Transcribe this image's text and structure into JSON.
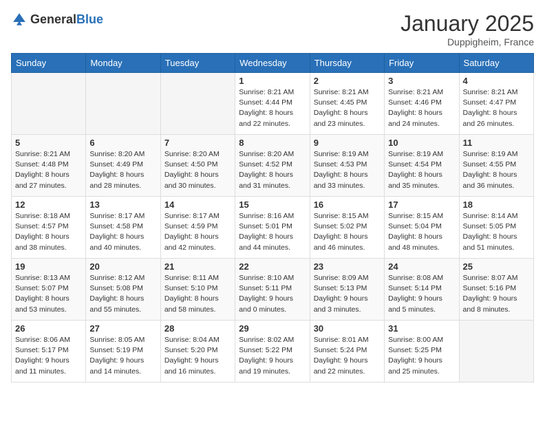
{
  "header": {
    "logo_general": "General",
    "logo_blue": "Blue",
    "title": "January 2025",
    "subtitle": "Duppigheim, France"
  },
  "columns": [
    "Sunday",
    "Monday",
    "Tuesday",
    "Wednesday",
    "Thursday",
    "Friday",
    "Saturday"
  ],
  "weeks": [
    [
      {
        "day": "",
        "info": ""
      },
      {
        "day": "",
        "info": ""
      },
      {
        "day": "",
        "info": ""
      },
      {
        "day": "1",
        "info": "Sunrise: 8:21 AM\nSunset: 4:44 PM\nDaylight: 8 hours\nand 22 minutes."
      },
      {
        "day": "2",
        "info": "Sunrise: 8:21 AM\nSunset: 4:45 PM\nDaylight: 8 hours\nand 23 minutes."
      },
      {
        "day": "3",
        "info": "Sunrise: 8:21 AM\nSunset: 4:46 PM\nDaylight: 8 hours\nand 24 minutes."
      },
      {
        "day": "4",
        "info": "Sunrise: 8:21 AM\nSunset: 4:47 PM\nDaylight: 8 hours\nand 26 minutes."
      }
    ],
    [
      {
        "day": "5",
        "info": "Sunrise: 8:21 AM\nSunset: 4:48 PM\nDaylight: 8 hours\nand 27 minutes."
      },
      {
        "day": "6",
        "info": "Sunrise: 8:20 AM\nSunset: 4:49 PM\nDaylight: 8 hours\nand 28 minutes."
      },
      {
        "day": "7",
        "info": "Sunrise: 8:20 AM\nSunset: 4:50 PM\nDaylight: 8 hours\nand 30 minutes."
      },
      {
        "day": "8",
        "info": "Sunrise: 8:20 AM\nSunset: 4:52 PM\nDaylight: 8 hours\nand 31 minutes."
      },
      {
        "day": "9",
        "info": "Sunrise: 8:19 AM\nSunset: 4:53 PM\nDaylight: 8 hours\nand 33 minutes."
      },
      {
        "day": "10",
        "info": "Sunrise: 8:19 AM\nSunset: 4:54 PM\nDaylight: 8 hours\nand 35 minutes."
      },
      {
        "day": "11",
        "info": "Sunrise: 8:19 AM\nSunset: 4:55 PM\nDaylight: 8 hours\nand 36 minutes."
      }
    ],
    [
      {
        "day": "12",
        "info": "Sunrise: 8:18 AM\nSunset: 4:57 PM\nDaylight: 8 hours\nand 38 minutes."
      },
      {
        "day": "13",
        "info": "Sunrise: 8:17 AM\nSunset: 4:58 PM\nDaylight: 8 hours\nand 40 minutes."
      },
      {
        "day": "14",
        "info": "Sunrise: 8:17 AM\nSunset: 4:59 PM\nDaylight: 8 hours\nand 42 minutes."
      },
      {
        "day": "15",
        "info": "Sunrise: 8:16 AM\nSunset: 5:01 PM\nDaylight: 8 hours\nand 44 minutes."
      },
      {
        "day": "16",
        "info": "Sunrise: 8:15 AM\nSunset: 5:02 PM\nDaylight: 8 hours\nand 46 minutes."
      },
      {
        "day": "17",
        "info": "Sunrise: 8:15 AM\nSunset: 5:04 PM\nDaylight: 8 hours\nand 48 minutes."
      },
      {
        "day": "18",
        "info": "Sunrise: 8:14 AM\nSunset: 5:05 PM\nDaylight: 8 hours\nand 51 minutes."
      }
    ],
    [
      {
        "day": "19",
        "info": "Sunrise: 8:13 AM\nSunset: 5:07 PM\nDaylight: 8 hours\nand 53 minutes."
      },
      {
        "day": "20",
        "info": "Sunrise: 8:12 AM\nSunset: 5:08 PM\nDaylight: 8 hours\nand 55 minutes."
      },
      {
        "day": "21",
        "info": "Sunrise: 8:11 AM\nSunset: 5:10 PM\nDaylight: 8 hours\nand 58 minutes."
      },
      {
        "day": "22",
        "info": "Sunrise: 8:10 AM\nSunset: 5:11 PM\nDaylight: 9 hours\nand 0 minutes."
      },
      {
        "day": "23",
        "info": "Sunrise: 8:09 AM\nSunset: 5:13 PM\nDaylight: 9 hours\nand 3 minutes."
      },
      {
        "day": "24",
        "info": "Sunrise: 8:08 AM\nSunset: 5:14 PM\nDaylight: 9 hours\nand 5 minutes."
      },
      {
        "day": "25",
        "info": "Sunrise: 8:07 AM\nSunset: 5:16 PM\nDaylight: 9 hours\nand 8 minutes."
      }
    ],
    [
      {
        "day": "26",
        "info": "Sunrise: 8:06 AM\nSunset: 5:17 PM\nDaylight: 9 hours\nand 11 minutes."
      },
      {
        "day": "27",
        "info": "Sunrise: 8:05 AM\nSunset: 5:19 PM\nDaylight: 9 hours\nand 14 minutes."
      },
      {
        "day": "28",
        "info": "Sunrise: 8:04 AM\nSunset: 5:20 PM\nDaylight: 9 hours\nand 16 minutes."
      },
      {
        "day": "29",
        "info": "Sunrise: 8:02 AM\nSunset: 5:22 PM\nDaylight: 9 hours\nand 19 minutes."
      },
      {
        "day": "30",
        "info": "Sunrise: 8:01 AM\nSunset: 5:24 PM\nDaylight: 9 hours\nand 22 minutes."
      },
      {
        "day": "31",
        "info": "Sunrise: 8:00 AM\nSunset: 5:25 PM\nDaylight: 9 hours\nand 25 minutes."
      },
      {
        "day": "",
        "info": ""
      }
    ]
  ]
}
